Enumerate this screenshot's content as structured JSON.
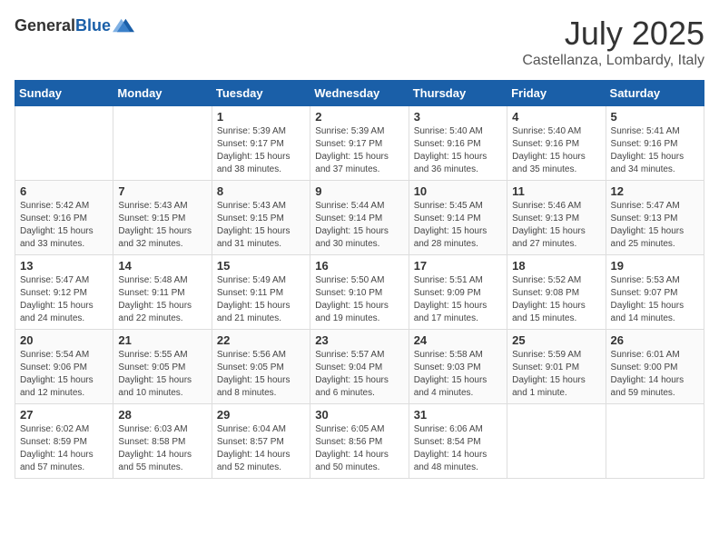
{
  "header": {
    "logo_general": "General",
    "logo_blue": "Blue",
    "month": "July 2025",
    "location": "Castellanza, Lombardy, Italy"
  },
  "weekdays": [
    "Sunday",
    "Monday",
    "Tuesday",
    "Wednesday",
    "Thursday",
    "Friday",
    "Saturday"
  ],
  "weeks": [
    [
      {
        "day": "",
        "sunrise": "",
        "sunset": "",
        "daylight": ""
      },
      {
        "day": "",
        "sunrise": "",
        "sunset": "",
        "daylight": ""
      },
      {
        "day": "1",
        "sunrise": "Sunrise: 5:39 AM",
        "sunset": "Sunset: 9:17 PM",
        "daylight": "Daylight: 15 hours and 38 minutes."
      },
      {
        "day": "2",
        "sunrise": "Sunrise: 5:39 AM",
        "sunset": "Sunset: 9:17 PM",
        "daylight": "Daylight: 15 hours and 37 minutes."
      },
      {
        "day": "3",
        "sunrise": "Sunrise: 5:40 AM",
        "sunset": "Sunset: 9:16 PM",
        "daylight": "Daylight: 15 hours and 36 minutes."
      },
      {
        "day": "4",
        "sunrise": "Sunrise: 5:40 AM",
        "sunset": "Sunset: 9:16 PM",
        "daylight": "Daylight: 15 hours and 35 minutes."
      },
      {
        "day": "5",
        "sunrise": "Sunrise: 5:41 AM",
        "sunset": "Sunset: 9:16 PM",
        "daylight": "Daylight: 15 hours and 34 minutes."
      }
    ],
    [
      {
        "day": "6",
        "sunrise": "Sunrise: 5:42 AM",
        "sunset": "Sunset: 9:16 PM",
        "daylight": "Daylight: 15 hours and 33 minutes."
      },
      {
        "day": "7",
        "sunrise": "Sunrise: 5:43 AM",
        "sunset": "Sunset: 9:15 PM",
        "daylight": "Daylight: 15 hours and 32 minutes."
      },
      {
        "day": "8",
        "sunrise": "Sunrise: 5:43 AM",
        "sunset": "Sunset: 9:15 PM",
        "daylight": "Daylight: 15 hours and 31 minutes."
      },
      {
        "day": "9",
        "sunrise": "Sunrise: 5:44 AM",
        "sunset": "Sunset: 9:14 PM",
        "daylight": "Daylight: 15 hours and 30 minutes."
      },
      {
        "day": "10",
        "sunrise": "Sunrise: 5:45 AM",
        "sunset": "Sunset: 9:14 PM",
        "daylight": "Daylight: 15 hours and 28 minutes."
      },
      {
        "day": "11",
        "sunrise": "Sunrise: 5:46 AM",
        "sunset": "Sunset: 9:13 PM",
        "daylight": "Daylight: 15 hours and 27 minutes."
      },
      {
        "day": "12",
        "sunrise": "Sunrise: 5:47 AM",
        "sunset": "Sunset: 9:13 PM",
        "daylight": "Daylight: 15 hours and 25 minutes."
      }
    ],
    [
      {
        "day": "13",
        "sunrise": "Sunrise: 5:47 AM",
        "sunset": "Sunset: 9:12 PM",
        "daylight": "Daylight: 15 hours and 24 minutes."
      },
      {
        "day": "14",
        "sunrise": "Sunrise: 5:48 AM",
        "sunset": "Sunset: 9:11 PM",
        "daylight": "Daylight: 15 hours and 22 minutes."
      },
      {
        "day": "15",
        "sunrise": "Sunrise: 5:49 AM",
        "sunset": "Sunset: 9:11 PM",
        "daylight": "Daylight: 15 hours and 21 minutes."
      },
      {
        "day": "16",
        "sunrise": "Sunrise: 5:50 AM",
        "sunset": "Sunset: 9:10 PM",
        "daylight": "Daylight: 15 hours and 19 minutes."
      },
      {
        "day": "17",
        "sunrise": "Sunrise: 5:51 AM",
        "sunset": "Sunset: 9:09 PM",
        "daylight": "Daylight: 15 hours and 17 minutes."
      },
      {
        "day": "18",
        "sunrise": "Sunrise: 5:52 AM",
        "sunset": "Sunset: 9:08 PM",
        "daylight": "Daylight: 15 hours and 15 minutes."
      },
      {
        "day": "19",
        "sunrise": "Sunrise: 5:53 AM",
        "sunset": "Sunset: 9:07 PM",
        "daylight": "Daylight: 15 hours and 14 minutes."
      }
    ],
    [
      {
        "day": "20",
        "sunrise": "Sunrise: 5:54 AM",
        "sunset": "Sunset: 9:06 PM",
        "daylight": "Daylight: 15 hours and 12 minutes."
      },
      {
        "day": "21",
        "sunrise": "Sunrise: 5:55 AM",
        "sunset": "Sunset: 9:05 PM",
        "daylight": "Daylight: 15 hours and 10 minutes."
      },
      {
        "day": "22",
        "sunrise": "Sunrise: 5:56 AM",
        "sunset": "Sunset: 9:05 PM",
        "daylight": "Daylight: 15 hours and 8 minutes."
      },
      {
        "day": "23",
        "sunrise": "Sunrise: 5:57 AM",
        "sunset": "Sunset: 9:04 PM",
        "daylight": "Daylight: 15 hours and 6 minutes."
      },
      {
        "day": "24",
        "sunrise": "Sunrise: 5:58 AM",
        "sunset": "Sunset: 9:03 PM",
        "daylight": "Daylight: 15 hours and 4 minutes."
      },
      {
        "day": "25",
        "sunrise": "Sunrise: 5:59 AM",
        "sunset": "Sunset: 9:01 PM",
        "daylight": "Daylight: 15 hours and 1 minute."
      },
      {
        "day": "26",
        "sunrise": "Sunrise: 6:01 AM",
        "sunset": "Sunset: 9:00 PM",
        "daylight": "Daylight: 14 hours and 59 minutes."
      }
    ],
    [
      {
        "day": "27",
        "sunrise": "Sunrise: 6:02 AM",
        "sunset": "Sunset: 8:59 PM",
        "daylight": "Daylight: 14 hours and 57 minutes."
      },
      {
        "day": "28",
        "sunrise": "Sunrise: 6:03 AM",
        "sunset": "Sunset: 8:58 PM",
        "daylight": "Daylight: 14 hours and 55 minutes."
      },
      {
        "day": "29",
        "sunrise": "Sunrise: 6:04 AM",
        "sunset": "Sunset: 8:57 PM",
        "daylight": "Daylight: 14 hours and 52 minutes."
      },
      {
        "day": "30",
        "sunrise": "Sunrise: 6:05 AM",
        "sunset": "Sunset: 8:56 PM",
        "daylight": "Daylight: 14 hours and 50 minutes."
      },
      {
        "day": "31",
        "sunrise": "Sunrise: 6:06 AM",
        "sunset": "Sunset: 8:54 PM",
        "daylight": "Daylight: 14 hours and 48 minutes."
      },
      {
        "day": "",
        "sunrise": "",
        "sunset": "",
        "daylight": ""
      },
      {
        "day": "",
        "sunrise": "",
        "sunset": "",
        "daylight": ""
      }
    ]
  ]
}
